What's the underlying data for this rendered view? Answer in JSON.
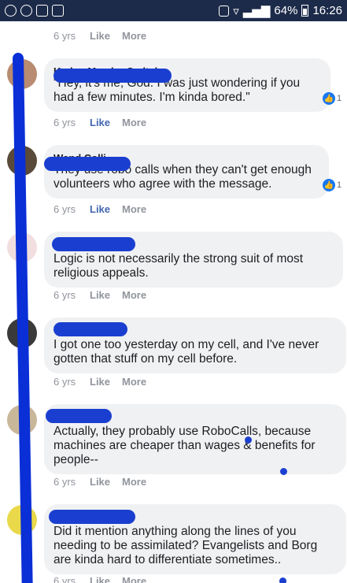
{
  "status_bar": {
    "battery": "64%",
    "time": "16:26"
  },
  "colors": {
    "status_bar": "#1d2b4a",
    "bubble": "#f0f1f3",
    "like_active": "#4267b2",
    "scribble": "#1a3fd0"
  },
  "top_row": {
    "time": "6 yrs",
    "like": "Like",
    "more": "More"
  },
  "comments": [
    {
      "name": "Kaden Meador Sedtal",
      "text": "\"Hey, it's me, God. I was just wondering if you had a few minutes. I'm kinda bored.\"",
      "time": "6 yrs",
      "like": "Like",
      "more": "More",
      "liked": true,
      "reactions": "1"
    },
    {
      "name": "Wend Colli",
      "text": "They use robo calls when they can't get enough volunteers who agree with the message.",
      "time": "6 yrs",
      "like": "Like",
      "more": "More",
      "liked": true,
      "reactions": "1"
    },
    {
      "name": "",
      "text": "Logic is not necessarily the strong suit of most religious appeals.",
      "time": "6 yrs",
      "like": "Like",
      "more": "More",
      "liked": false
    },
    {
      "name": "",
      "text": "I got one too yesterday on my cell, and I've never gotten that stuff on my cell before.",
      "time": "6 yrs",
      "like": "Like",
      "more": "More",
      "liked": false
    },
    {
      "name": "",
      "text": "Actually, they probably use RoboCalls, because machines are cheaper than wages & benefits for people--",
      "time": "6 yrs",
      "like": "Like",
      "more": "More",
      "liked": false
    },
    {
      "name": "",
      "text": "Did it mention anything along the lines of you needing to be assimilated? Evangelists and Borg are kinda hard to differentiate sometimes..",
      "time": "6 yrs",
      "like": "Like",
      "more": "More",
      "liked": false
    }
  ]
}
